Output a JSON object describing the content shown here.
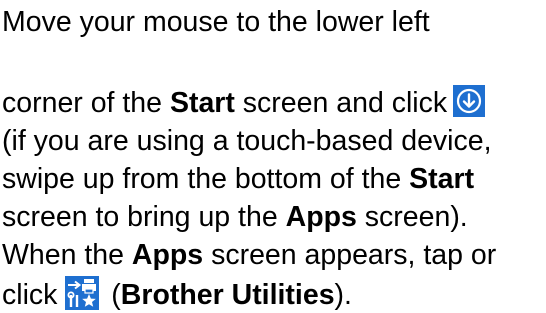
{
  "cut_line": "); ",
  "line1": "Move your mouse to the lower left",
  "line2_pre": "corner of the ",
  "line2_bold": "Start",
  "line2_post": " screen and click",
  "line3": "(if you are using a touch-based device,",
  "line4_pre": "swipe up from the bottom of the ",
  "line4_bold": "Start",
  "line5_pre": "screen to bring up the ",
  "line5_bold": "Apps",
  "line5_post": " screen).",
  "line6_pre": "When the ",
  "line6_bold": "Apps",
  "line6_post": " screen appears, tap or",
  "line7_pre": "click",
  "line7_paren_open": " (",
  "line7_bold": "Brother Utilities",
  "line7_post": ").",
  "icons": {
    "apps_arrow": "down-arrow-circle-icon",
    "brother_utilities": "brother-utilities-icon",
    "accent": "#1E6FD0"
  }
}
